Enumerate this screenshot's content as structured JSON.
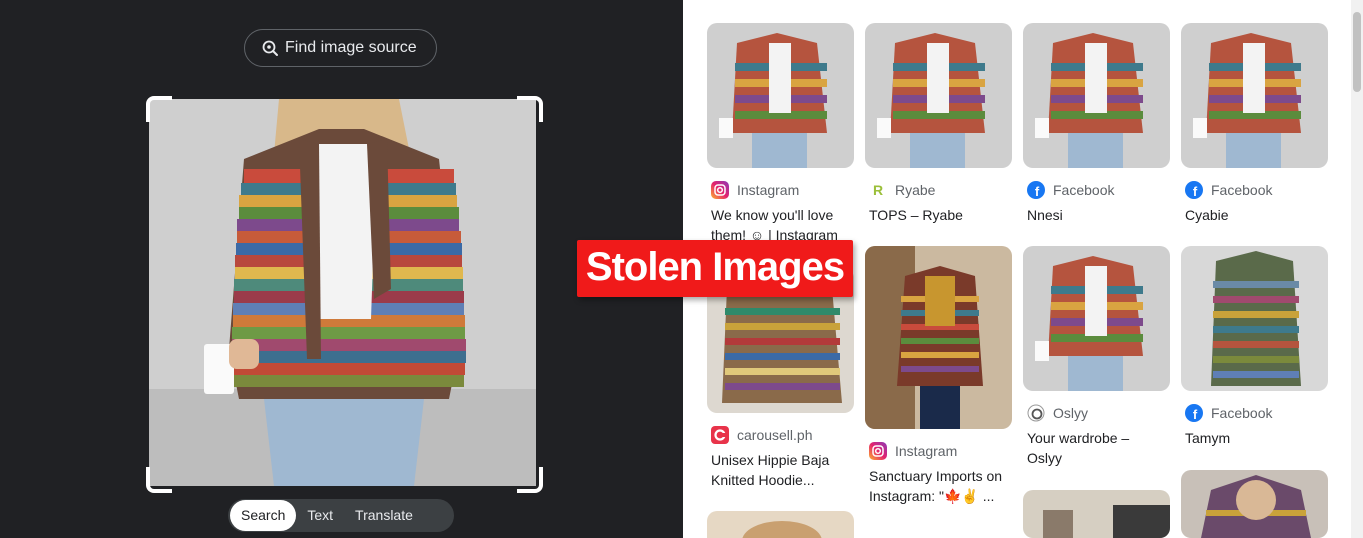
{
  "viewer": {
    "find_source_label": "Find image source",
    "modes": [
      "Search",
      "Text",
      "Translate"
    ]
  },
  "overlay": {
    "text": "Stolen Images"
  },
  "results": [
    {
      "source": "Instagram",
      "source_icon": "instagram-icon",
      "title": "We know you'll love them! ☺ | Instagram"
    },
    {
      "source": "Ryabe",
      "source_icon": "ryabe-icon",
      "title": "TOPS – Ryabe"
    },
    {
      "source": "Facebook",
      "source_icon": "facebook-icon",
      "title": "Nnesi"
    },
    {
      "source": "Facebook",
      "source_icon": "facebook-icon",
      "title": "Cyabie"
    },
    {
      "source": "carousell.ph",
      "source_icon": "carousell-icon",
      "title": "Unisex Hippie Baja Knitted Hoodie..."
    },
    {
      "source": "Instagram",
      "source_icon": "instagram-icon",
      "title": "Sanctuary Imports on Instagram: \"🍁✌ ..."
    },
    {
      "source": "Oslyy",
      "source_icon": "oslyy-icon",
      "title": "Your wardrobe – Oslyy"
    },
    {
      "source": "Facebook",
      "source_icon": "facebook-icon",
      "title": "Tamym"
    }
  ],
  "colors": {
    "viewer_bg": "#202124",
    "facebook": "#1877f2",
    "carousell": "#e8334a",
    "overlay_red": "#f01a1a"
  }
}
